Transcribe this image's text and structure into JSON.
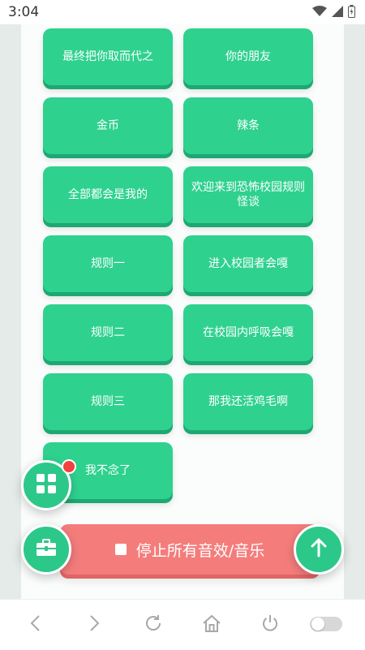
{
  "status_bar": {
    "time": "3:04"
  },
  "sound_buttons": [
    "最终把你取而代之",
    "你的朋友",
    "金币",
    "辣条",
    "全部都会是我的",
    "欢迎来到恐怖校园规则怪谈",
    "规则一",
    "进入校园者会嘎",
    "规则二",
    "在校园内呼吸会嘎",
    "规则三",
    "那我还活鸡毛啊",
    "我不念了"
  ],
  "stop_button": {
    "label": "停止所有音效/音乐"
  },
  "colors": {
    "accent": "#2fd18f",
    "accent_shadow": "#1da873",
    "stop": "#f47d7c",
    "badge": "#f0433f"
  },
  "icons": {
    "grid_fab": "grid-icon",
    "tool_fab": "toolbox-icon",
    "up_fab": "arrow-up-icon"
  },
  "nav": [
    "back-icon",
    "forward-icon",
    "refresh-icon",
    "home-icon",
    "power-icon",
    "toggle-switch"
  ]
}
